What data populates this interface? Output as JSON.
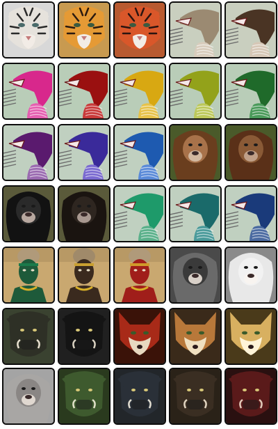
{
  "grid": {
    "rows": 7,
    "cols": 5,
    "thumbnails": [
      {
        "kind": "tiger",
        "palette": {
          "fur": "#e6e2dc",
          "stripe": "#2a2a2a",
          "bg": "#d8d8d8",
          "eye": "#4a6a6a"
        }
      },
      {
        "kind": "tiger",
        "palette": {
          "fur": "#e59a35",
          "stripe": "#2b1a10",
          "bg": "#c89a50",
          "eye": "#3a5a40"
        }
      },
      {
        "kind": "tiger",
        "palette": {
          "fur": "#d9572a",
          "stripe": "#2b1410",
          "bg": "#b85a30",
          "eye": "#3a5a40"
        }
      },
      {
        "kind": "hair-side",
        "palette": {
          "hair": "#9b8a72",
          "bg": "#c9cfbf",
          "neck": "#d8ccbc"
        }
      },
      {
        "kind": "hair-side",
        "palette": {
          "hair": "#4a3424",
          "bg": "#c9cfbf",
          "neck": "#d6c7b6"
        }
      },
      {
        "kind": "hair-side",
        "palette": {
          "hair": "#d8288c",
          "bg": "#b9cdb8",
          "neck": "#e55fb0"
        }
      },
      {
        "kind": "hair-side",
        "palette": {
          "hair": "#9a1010",
          "bg": "#b9cdb8",
          "neck": "#c83a3a"
        }
      },
      {
        "kind": "hair-side",
        "palette": {
          "hair": "#d8a812",
          "bg": "#b9cdb8",
          "neck": "#e6c24a"
        }
      },
      {
        "kind": "hair-side",
        "palette": {
          "hair": "#93a21a",
          "bg": "#b9cdb8",
          "neck": "#bcc85a"
        }
      },
      {
        "kind": "hair-side",
        "palette": {
          "hair": "#1f6a2a",
          "bg": "#b9cdb8",
          "neck": "#4a9a5a"
        }
      },
      {
        "kind": "hair-side",
        "palette": {
          "hair": "#5a1a6e",
          "bg": "#c0d0c0",
          "neck": "#9a6ab0"
        }
      },
      {
        "kind": "hair-side",
        "palette": {
          "hair": "#3a2a9a",
          "bg": "#c0d0c0",
          "neck": "#7a6ad0"
        }
      },
      {
        "kind": "hair-side",
        "palette": {
          "hair": "#1e5ab0",
          "bg": "#c0d0c0",
          "neck": "#5a8ad8"
        }
      },
      {
        "kind": "lion",
        "palette": {
          "mane": "#6a3e1e",
          "face": "#a8724a",
          "bg": "#4a5a2a",
          "muzzle": "#d2b8a0"
        }
      },
      {
        "kind": "lion",
        "palette": {
          "mane": "#5a3018",
          "face": "#8a5a36",
          "bg": "#4a5a2a",
          "muzzle": "#c0a088"
        }
      },
      {
        "kind": "lion",
        "palette": {
          "mane": "#121212",
          "face": "#2a2a2a",
          "bg": "#5a5a3a",
          "muzzle": "#b8a8a0"
        }
      },
      {
        "kind": "lion",
        "palette": {
          "mane": "#1a1410",
          "face": "#2e2620",
          "bg": "#5a5a3a",
          "muzzle": "#a89890"
        }
      },
      {
        "kind": "hair-side",
        "palette": {
          "hair": "#1e9a6a",
          "bg": "#c0d0c0",
          "neck": "#5ab08a"
        }
      },
      {
        "kind": "hair-side",
        "palette": {
          "hair": "#1a6a6a",
          "bg": "#c0d0c0",
          "neck": "#4a9a9a"
        }
      },
      {
        "kind": "hair-side",
        "palette": {
          "hair": "#1a3a7a",
          "bg": "#c0d0c0",
          "neck": "#4a6aa0"
        }
      },
      {
        "kind": "warrior",
        "palette": {
          "skin": "#1e5a3a",
          "hair": "#b09a7a",
          "bg": "#c9a870",
          "band": "#1a7a4a"
        }
      },
      {
        "kind": "warrior",
        "palette": {
          "skin": "#3a2a1e",
          "hair": "#a08a6a",
          "bg": "#c9a870",
          "band": "#c9a030"
        }
      },
      {
        "kind": "warrior",
        "palette": {
          "skin": "#a01e1a",
          "hair": "#b09a7a",
          "bg": "#c9a870",
          "band": "#d09a2a"
        }
      },
      {
        "kind": "lion",
        "palette": {
          "mane": "#6a6a6a",
          "face": "#3a3a3a",
          "bg": "#4a4a4a",
          "muzzle": "#d8d0c8"
        }
      },
      {
        "kind": "lion",
        "palette": {
          "mane": "#e8e8e8",
          "face": "#f2f2f2",
          "bg": "#8a8a8a",
          "muzzle": "#f8f4f0"
        }
      },
      {
        "kind": "boar",
        "palette": {
          "head": "#2e3026",
          "bg": "#3a4230",
          "tusk": "#e8e0d0"
        }
      },
      {
        "kind": "boar",
        "palette": {
          "head": "#141414",
          "bg": "#202020",
          "tusk": "#d8d0c0"
        }
      },
      {
        "kind": "fox",
        "palette": {
          "fur": "#a82a18",
          "bg": "#3a1208",
          "mask": "#e8d8c0"
        }
      },
      {
        "kind": "fox",
        "palette": {
          "fur": "#b8783a",
          "bg": "#3a2a1a",
          "mask": "#f0e0c0"
        }
      },
      {
        "kind": "fox",
        "palette": {
          "fur": "#d8b060",
          "bg": "#4a3a1a",
          "mask": "#fff4d8"
        }
      },
      {
        "kind": "lion",
        "palette": {
          "mane": "#a8a6a4",
          "face": "#8a8684",
          "bg": "#a4a4a4",
          "muzzle": "#e0d8d0"
        }
      },
      {
        "kind": "boar",
        "palette": {
          "head": "#3e5a2e",
          "bg": "#2a3a1e",
          "tusk": "#e0e0c8"
        }
      },
      {
        "kind": "boar",
        "palette": {
          "head": "#2a3038",
          "bg": "#22262a",
          "tusk": "#e0dcd0"
        }
      },
      {
        "kind": "boar",
        "palette": {
          "head": "#3a2e22",
          "bg": "#2a2218",
          "tusk": "#e0d4c0"
        }
      },
      {
        "kind": "boar",
        "palette": {
          "head": "#5a1a1a",
          "bg": "#2a1010",
          "tusk": "#e0c8b8"
        }
      }
    ]
  }
}
